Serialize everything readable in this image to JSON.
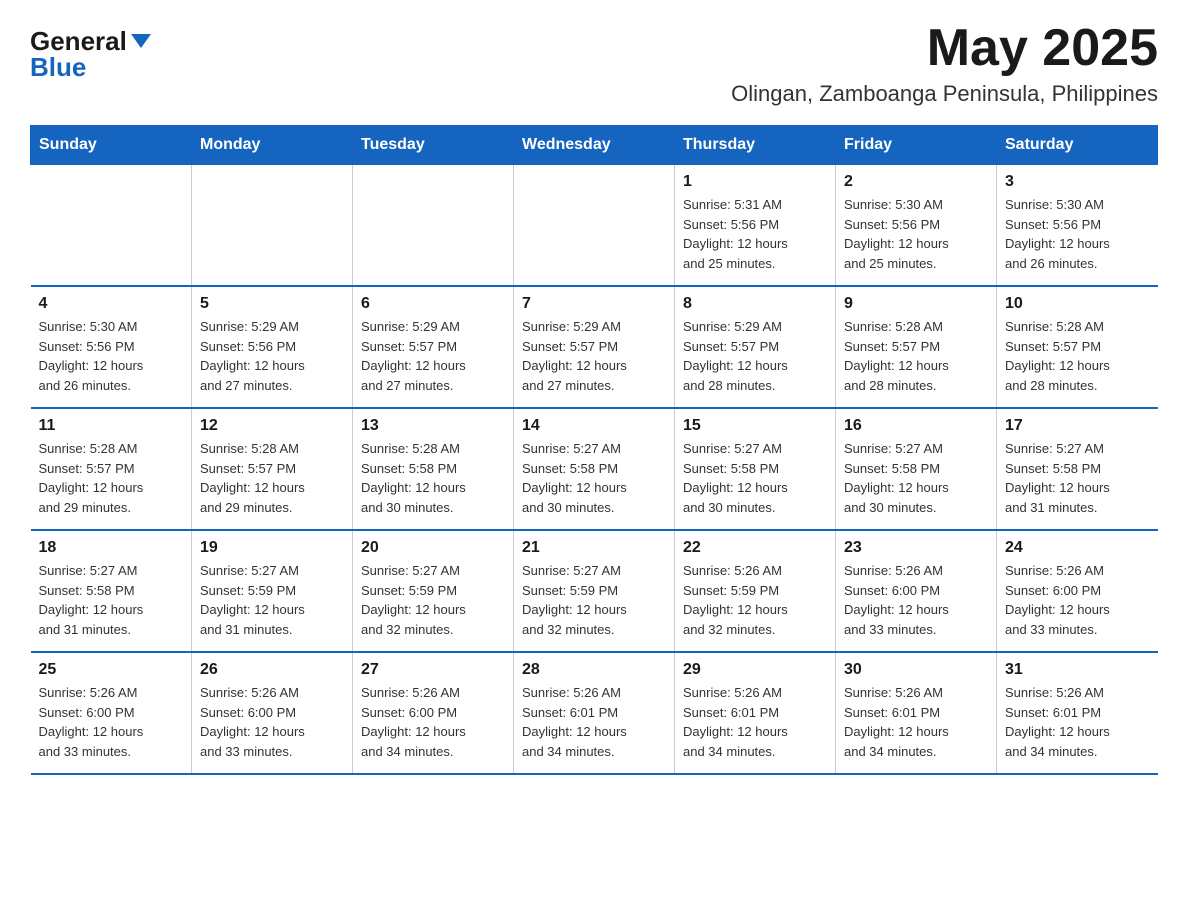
{
  "header": {
    "logo_general": "General",
    "logo_blue": "Blue",
    "month_title": "May 2025",
    "subtitle": "Olingan, Zamboanga Peninsula, Philippines"
  },
  "weekdays": [
    "Sunday",
    "Monday",
    "Tuesday",
    "Wednesday",
    "Thursday",
    "Friday",
    "Saturday"
  ],
  "weeks": [
    [
      {
        "day": "",
        "info": ""
      },
      {
        "day": "",
        "info": ""
      },
      {
        "day": "",
        "info": ""
      },
      {
        "day": "",
        "info": ""
      },
      {
        "day": "1",
        "info": "Sunrise: 5:31 AM\nSunset: 5:56 PM\nDaylight: 12 hours\nand 25 minutes."
      },
      {
        "day": "2",
        "info": "Sunrise: 5:30 AM\nSunset: 5:56 PM\nDaylight: 12 hours\nand 25 minutes."
      },
      {
        "day": "3",
        "info": "Sunrise: 5:30 AM\nSunset: 5:56 PM\nDaylight: 12 hours\nand 26 minutes."
      }
    ],
    [
      {
        "day": "4",
        "info": "Sunrise: 5:30 AM\nSunset: 5:56 PM\nDaylight: 12 hours\nand 26 minutes."
      },
      {
        "day": "5",
        "info": "Sunrise: 5:29 AM\nSunset: 5:56 PM\nDaylight: 12 hours\nand 27 minutes."
      },
      {
        "day": "6",
        "info": "Sunrise: 5:29 AM\nSunset: 5:57 PM\nDaylight: 12 hours\nand 27 minutes."
      },
      {
        "day": "7",
        "info": "Sunrise: 5:29 AM\nSunset: 5:57 PM\nDaylight: 12 hours\nand 27 minutes."
      },
      {
        "day": "8",
        "info": "Sunrise: 5:29 AM\nSunset: 5:57 PM\nDaylight: 12 hours\nand 28 minutes."
      },
      {
        "day": "9",
        "info": "Sunrise: 5:28 AM\nSunset: 5:57 PM\nDaylight: 12 hours\nand 28 minutes."
      },
      {
        "day": "10",
        "info": "Sunrise: 5:28 AM\nSunset: 5:57 PM\nDaylight: 12 hours\nand 28 minutes."
      }
    ],
    [
      {
        "day": "11",
        "info": "Sunrise: 5:28 AM\nSunset: 5:57 PM\nDaylight: 12 hours\nand 29 minutes."
      },
      {
        "day": "12",
        "info": "Sunrise: 5:28 AM\nSunset: 5:57 PM\nDaylight: 12 hours\nand 29 minutes."
      },
      {
        "day": "13",
        "info": "Sunrise: 5:28 AM\nSunset: 5:58 PM\nDaylight: 12 hours\nand 30 minutes."
      },
      {
        "day": "14",
        "info": "Sunrise: 5:27 AM\nSunset: 5:58 PM\nDaylight: 12 hours\nand 30 minutes."
      },
      {
        "day": "15",
        "info": "Sunrise: 5:27 AM\nSunset: 5:58 PM\nDaylight: 12 hours\nand 30 minutes."
      },
      {
        "day": "16",
        "info": "Sunrise: 5:27 AM\nSunset: 5:58 PM\nDaylight: 12 hours\nand 30 minutes."
      },
      {
        "day": "17",
        "info": "Sunrise: 5:27 AM\nSunset: 5:58 PM\nDaylight: 12 hours\nand 31 minutes."
      }
    ],
    [
      {
        "day": "18",
        "info": "Sunrise: 5:27 AM\nSunset: 5:58 PM\nDaylight: 12 hours\nand 31 minutes."
      },
      {
        "day": "19",
        "info": "Sunrise: 5:27 AM\nSunset: 5:59 PM\nDaylight: 12 hours\nand 31 minutes."
      },
      {
        "day": "20",
        "info": "Sunrise: 5:27 AM\nSunset: 5:59 PM\nDaylight: 12 hours\nand 32 minutes."
      },
      {
        "day": "21",
        "info": "Sunrise: 5:27 AM\nSunset: 5:59 PM\nDaylight: 12 hours\nand 32 minutes."
      },
      {
        "day": "22",
        "info": "Sunrise: 5:26 AM\nSunset: 5:59 PM\nDaylight: 12 hours\nand 32 minutes."
      },
      {
        "day": "23",
        "info": "Sunrise: 5:26 AM\nSunset: 6:00 PM\nDaylight: 12 hours\nand 33 minutes."
      },
      {
        "day": "24",
        "info": "Sunrise: 5:26 AM\nSunset: 6:00 PM\nDaylight: 12 hours\nand 33 minutes."
      }
    ],
    [
      {
        "day": "25",
        "info": "Sunrise: 5:26 AM\nSunset: 6:00 PM\nDaylight: 12 hours\nand 33 minutes."
      },
      {
        "day": "26",
        "info": "Sunrise: 5:26 AM\nSunset: 6:00 PM\nDaylight: 12 hours\nand 33 minutes."
      },
      {
        "day": "27",
        "info": "Sunrise: 5:26 AM\nSunset: 6:00 PM\nDaylight: 12 hours\nand 34 minutes."
      },
      {
        "day": "28",
        "info": "Sunrise: 5:26 AM\nSunset: 6:01 PM\nDaylight: 12 hours\nand 34 minutes."
      },
      {
        "day": "29",
        "info": "Sunrise: 5:26 AM\nSunset: 6:01 PM\nDaylight: 12 hours\nand 34 minutes."
      },
      {
        "day": "30",
        "info": "Sunrise: 5:26 AM\nSunset: 6:01 PM\nDaylight: 12 hours\nand 34 minutes."
      },
      {
        "day": "31",
        "info": "Sunrise: 5:26 AM\nSunset: 6:01 PM\nDaylight: 12 hours\nand 34 minutes."
      }
    ]
  ]
}
